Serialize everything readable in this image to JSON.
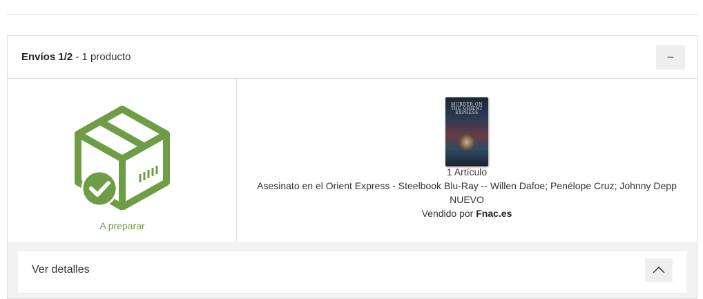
{
  "shipment": {
    "title": "Envíos 1/2",
    "separator": " - ",
    "count": "1 producto",
    "collapse_label": "–",
    "status": {
      "label": "A preparar",
      "icon": "package-check-icon",
      "color": "#6e9d46"
    },
    "item": {
      "cover_title": "MURDER ON THE ORIENT EXPRESS",
      "quantity": "1 Artículo",
      "name": "Asesinato en el Orient Express - Steelbook Blu-Ray -- Willen Dafoe; Penélope Cruz; Johnny Depp",
      "condition": "NUEVO",
      "seller_prefix": "Vendido por ",
      "seller_name": "Fnac.es"
    },
    "details": {
      "label": "Ver detalles",
      "toggle_icon": "chevron-up-icon"
    }
  }
}
